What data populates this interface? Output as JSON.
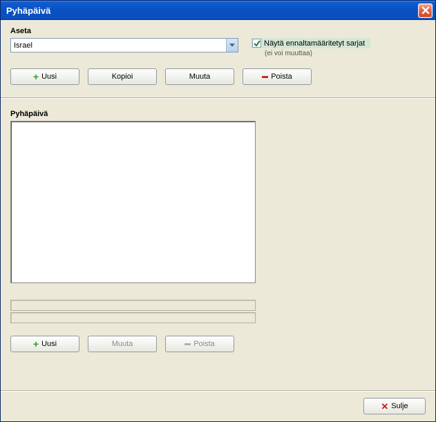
{
  "window": {
    "title": "Pyhäpäivä"
  },
  "top": {
    "section_label": "Aseta",
    "selected_value": "Israel",
    "checkbox_label": "Näytä ennaltamääritetyt sarjat",
    "checkbox_hint": "(ei voi muuttaa)",
    "checkbox_checked": true,
    "buttons": {
      "new": "Uusi",
      "copy": "Kopioi",
      "edit": "Muuta",
      "delete": "Poista"
    }
  },
  "bottom": {
    "section_label": "Pyhäpäivä",
    "items": [],
    "buttons": {
      "new": "Uusi",
      "edit": "Muuta",
      "delete": "Poista"
    }
  },
  "footer": {
    "close": "Sulje"
  }
}
